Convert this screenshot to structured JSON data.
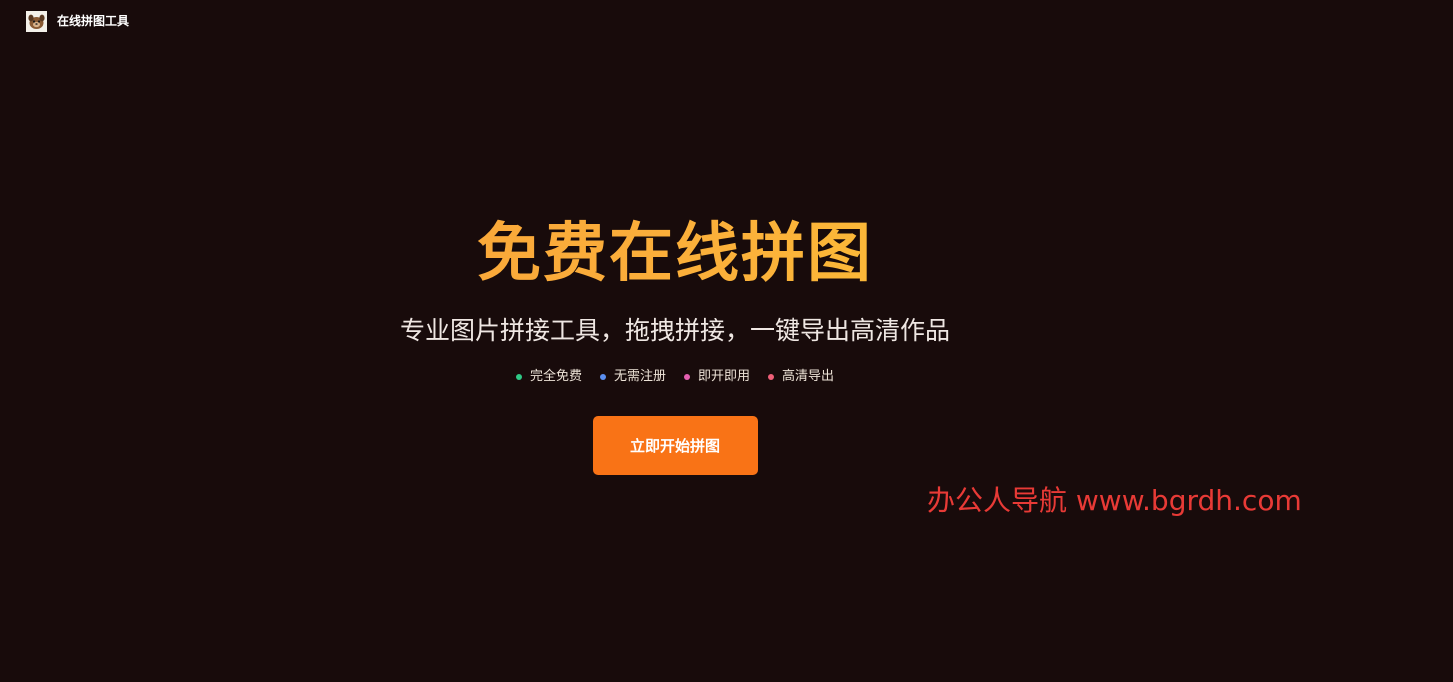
{
  "header": {
    "site_name": "在线拼图工具",
    "logo_icon": "dog-avatar-icon"
  },
  "hero": {
    "title": "免费在线拼图",
    "subtitle": "专业图片拼接工具，拖拽拼接，一键导出高清作品",
    "features": [
      {
        "label": "完全免费",
        "dot_color": "#2fc986"
      },
      {
        "label": "无需注册",
        "dot_color": "#5b8ff0"
      },
      {
        "label": "即开即用",
        "dot_color": "#e45fb0"
      },
      {
        "label": "高清导出",
        "dot_color": "#ef5f78"
      }
    ],
    "cta_label": "立即开始拼图"
  },
  "watermark": {
    "text": "办公人导航 www.bgrdh.com"
  },
  "colors": {
    "background": "#180b0b",
    "title_gradient_start": "#f99a38",
    "title_gradient_end": "#fcd02e",
    "cta": "#f97316",
    "watermark": "#e83a36"
  }
}
